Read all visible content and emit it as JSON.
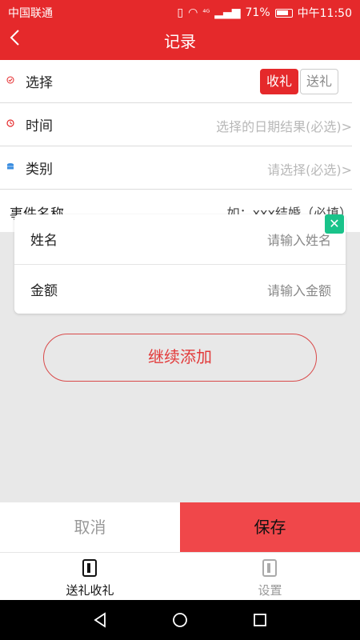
{
  "status_bar": {
    "carrier": "中国联通",
    "signal": "⁴ᴳ",
    "battery": "71%",
    "time": "中午11:50"
  },
  "nav_bar": {
    "back_icon": "chevron-left-icon",
    "title": "记录"
  },
  "form": {
    "select": {
      "label": "选择",
      "options": [
        "收礼",
        "送礼"
      ],
      "selected": "收礼"
    },
    "time": {
      "label": "时间",
      "value": "选择的日期结果(必选)>"
    },
    "category": {
      "label": "类别",
      "value": "请选择(必选)>"
    },
    "event": {
      "label": "事件名称",
      "value": "如：xxx结婚（必填）"
    }
  },
  "entry_card": {
    "name_label": "姓名",
    "name_placeholder": "请输入姓名",
    "amount_label": "金额",
    "amount_placeholder": "请输入金额",
    "close_symbol": "✕"
  },
  "continue_button": "继续添加",
  "actions": {
    "cancel": "取消",
    "save": "保存"
  },
  "tab_bar": {
    "tabs": [
      {
        "label": "送礼收礼",
        "icon": "book-icon",
        "active": true
      },
      {
        "label": "设置",
        "icon": "book-icon",
        "active": false
      }
    ]
  },
  "colors": {
    "primary": "#e5292b",
    "save_button": "#f0474a",
    "close_badge": "#19c38a"
  }
}
